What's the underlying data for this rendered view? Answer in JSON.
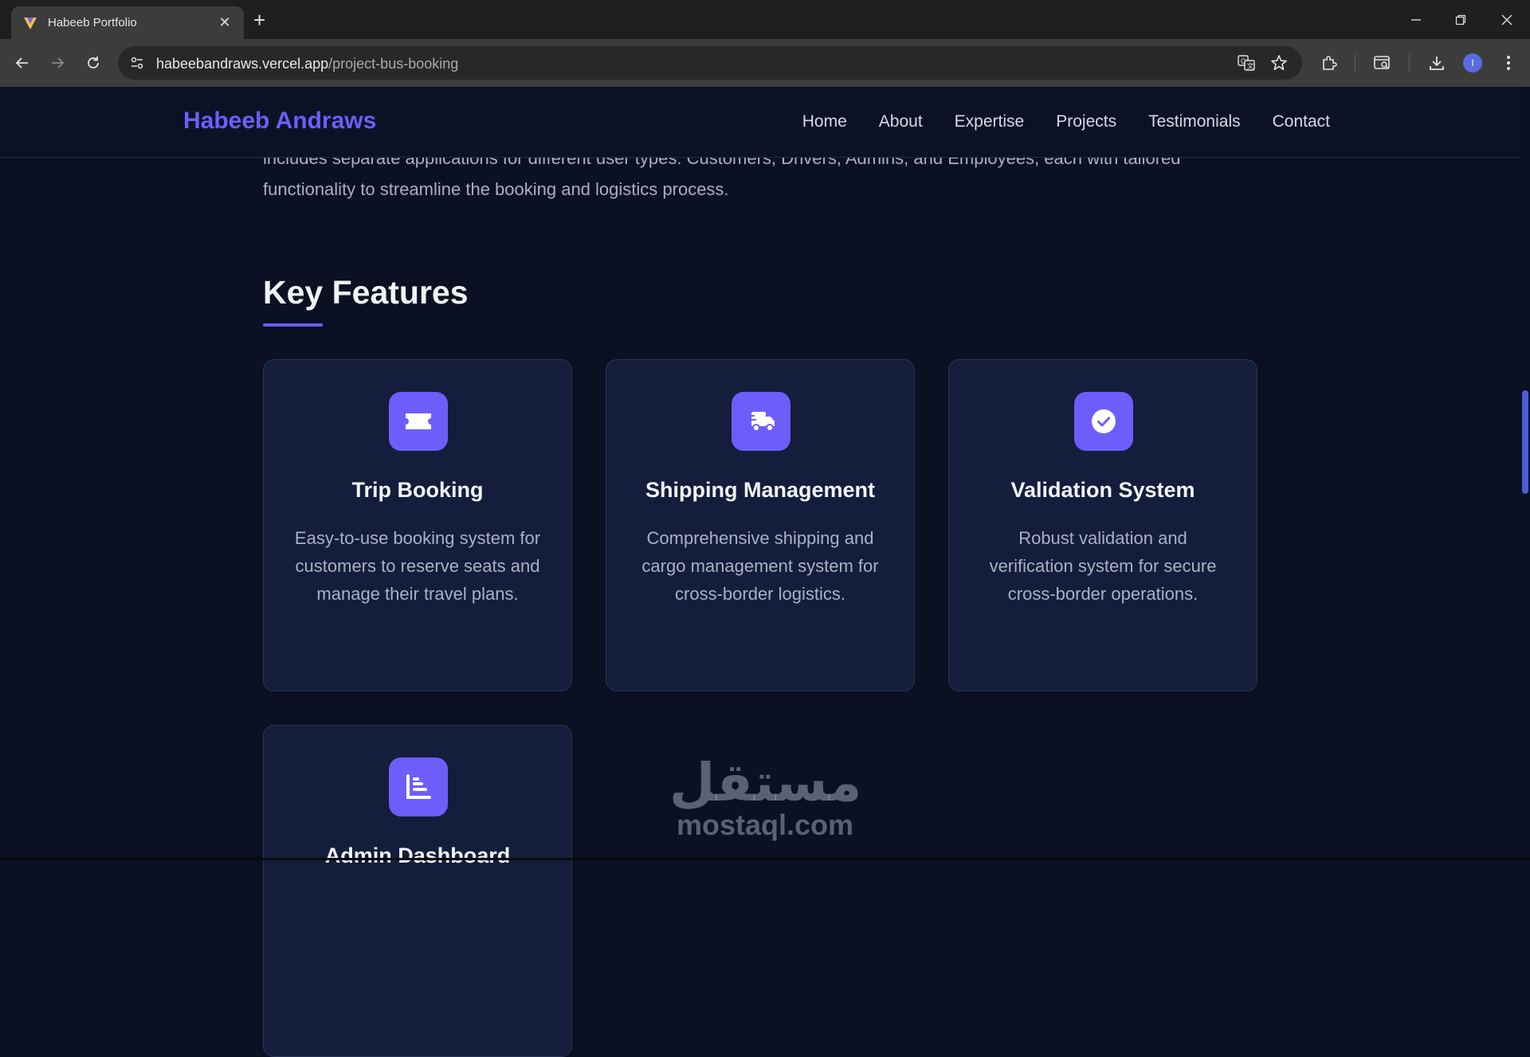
{
  "browser": {
    "tab_title": "Habeeb Portfolio",
    "new_tab_symbol": "+",
    "url_host": "habeebandraws.vercel.app",
    "url_path": "/project-bus-booking",
    "profile_initial": "I"
  },
  "site": {
    "logo": "Habeeb Andraws",
    "nav": [
      "Home",
      "About",
      "Expertise",
      "Projects",
      "Testimonials",
      "Contact"
    ]
  },
  "content": {
    "intro_line1": "includes separate applications for different user types: Customers, Drivers, Admins, and Employees, each with tailored",
    "intro_line2": "functionality to streamline the booking and logistics process.",
    "section_title": "Key Features",
    "features": [
      {
        "title": "Trip Booking",
        "description": "Easy-to-use booking system for customers to reserve seats and manage their travel plans.",
        "icon": "ticket-icon"
      },
      {
        "title": "Shipping Management",
        "description": "Comprehensive shipping and cargo management system for cross-border logistics.",
        "icon": "shipping-truck-icon"
      },
      {
        "title": "Validation System",
        "description": "Robust validation and verification system for secure cross-border operations.",
        "icon": "check-circle-icon"
      },
      {
        "title": "Admin Dashboard",
        "description": "",
        "icon": "chart-icon"
      }
    ]
  },
  "watermark": {
    "arabic": "مستقل",
    "latin": "mostaql.com"
  },
  "colors": {
    "accent": "#6d5efc",
    "page_bg": "#0b1023",
    "card_bg": "#141d3b"
  }
}
